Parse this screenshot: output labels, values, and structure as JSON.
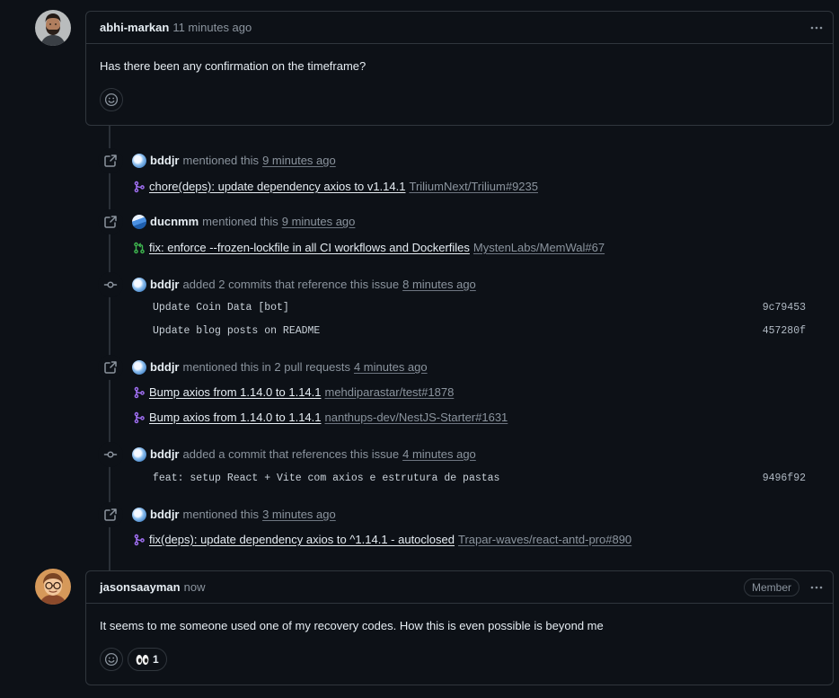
{
  "comments": [
    {
      "author": "abhi-markan",
      "time": "11 minutes ago",
      "body": "Has there been any confirmation on the timeframe?",
      "menu_icon": "kebab-horizontal-icon",
      "add_reaction_icon": "smiley-icon"
    },
    {
      "author": "jasonsaayman",
      "time": "now",
      "badge": "Member",
      "body": "It seems to me someone used one of my recovery codes. How this is even possible is beyond me",
      "menu_icon": "kebab-horizontal-icon",
      "add_reaction_icon": "smiley-icon",
      "reactions": [
        {
          "icon": "eyes-icon",
          "count": "1"
        }
      ]
    }
  ],
  "timeline": [
    {
      "icon": "cross-reference-icon",
      "actor": "bddjr",
      "action": "mentioned this",
      "time": "9 minutes ago",
      "refs": [
        {
          "state_icon": "git-merge-icon",
          "state_color": "#a371f7",
          "title": "chore(deps): update dependency axios to v1.14.1",
          "repo": "TriliumNext/Trilium#9235"
        }
      ]
    },
    {
      "icon": "cross-reference-icon",
      "actor": "ducnmm",
      "action": "mentioned this",
      "time": "9 minutes ago",
      "refs": [
        {
          "state_icon": "git-pull-request-icon",
          "state_color": "#3fb950",
          "title": "fix: enforce --frozen-lockfile in all CI workflows and Dockerfiles",
          "repo": "MystenLabs/MemWal#67"
        }
      ]
    },
    {
      "icon": "git-commit-icon",
      "actor": "bddjr",
      "action": "added 2 commits that reference this issue",
      "time": "8 minutes ago",
      "commits": [
        {
          "message": "Update Coin Data [bot]",
          "sha": "9c79453"
        },
        {
          "message": "Update blog posts on README",
          "sha": "457280f"
        }
      ]
    },
    {
      "icon": "cross-reference-icon",
      "actor": "bddjr",
      "action": "mentioned this in 2 pull requests",
      "time": "4 minutes ago",
      "refs": [
        {
          "state_icon": "git-merge-icon",
          "state_color": "#a371f7",
          "title": "Bump axios from 1.14.0 to 1.14.1",
          "repo": "mehdiparastar/test#1878"
        },
        {
          "state_icon": "git-merge-icon",
          "state_color": "#a371f7",
          "title": "Bump axios from 1.14.0 to 1.14.1",
          "repo": "nanthups-dev/NestJS-Starter#1631"
        }
      ]
    },
    {
      "icon": "git-commit-icon",
      "actor": "bddjr",
      "action": "added a commit that references this issue",
      "time": "4 minutes ago",
      "commits": [
        {
          "message": "feat: setup React + Vite com axios e estrutura de pastas",
          "sha": "9496f92"
        }
      ]
    },
    {
      "icon": "cross-reference-icon",
      "actor": "bddjr",
      "action": "mentioned this",
      "time": "3 minutes ago",
      "refs": [
        {
          "state_icon": "git-merge-icon",
          "state_color": "#a371f7",
          "title": "fix(deps): update dependency axios to ^1.14.1 - autoclosed",
          "repo": "Trapar-waves/react-antd-pro#890"
        }
      ]
    }
  ],
  "colors": {
    "background": "#0d1117",
    "border": "#30363d",
    "text": "#e6edf3",
    "muted": "#8b949e",
    "merged": "#a371f7",
    "open": "#3fb950"
  }
}
